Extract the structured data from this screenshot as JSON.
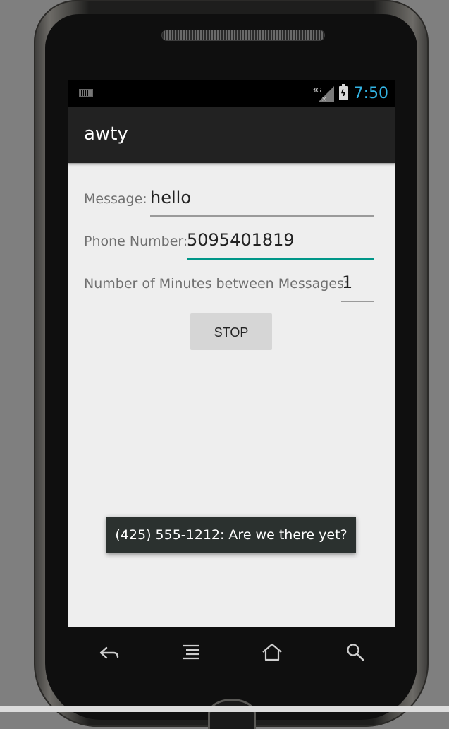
{
  "statusbar": {
    "network": "3G",
    "time": "7:50"
  },
  "actionbar": {
    "title": "awty"
  },
  "form": {
    "message_label": "Message:",
    "message_value": "hello",
    "phone_label": "Phone Number:",
    "phone_value": "5095401819",
    "minutes_label": "Number of Minutes between Messages:",
    "minutes_value": "1",
    "stop_label": "STOP"
  },
  "toast": {
    "text": "(425) 555-1212: Are we there yet?"
  },
  "colors": {
    "accent": "#009688",
    "clock": "#33b5e5",
    "actionbar": "#222222",
    "background": "#eeeeee"
  },
  "navbar": {
    "icons": [
      "back-icon",
      "recent-apps-icon",
      "home-icon",
      "search-icon"
    ]
  }
}
